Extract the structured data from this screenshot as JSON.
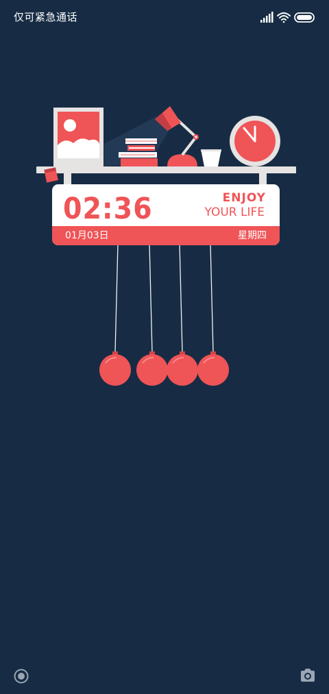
{
  "status_bar": {
    "carrier_text": "仅可紧急通话",
    "icons": [
      "signal-icon",
      "wifi-icon",
      "battery-icon"
    ]
  },
  "clock_card": {
    "time": "02:36",
    "tagline_line1": "ENJOY",
    "tagline_line2": "YOUR LIFE",
    "date": "01月03日",
    "weekday": "星期四"
  },
  "illustration": {
    "items": [
      "picture-frame",
      "books",
      "desk-lamp",
      "cup",
      "wall-clock",
      "newtons-cradle"
    ]
  },
  "bottom_bar": {
    "left_icon": "record-icon",
    "right_icon": "camera-icon"
  },
  "colors": {
    "background": "#172c44",
    "accent": "#ef5457",
    "shelf": "#e6e3e3"
  }
}
